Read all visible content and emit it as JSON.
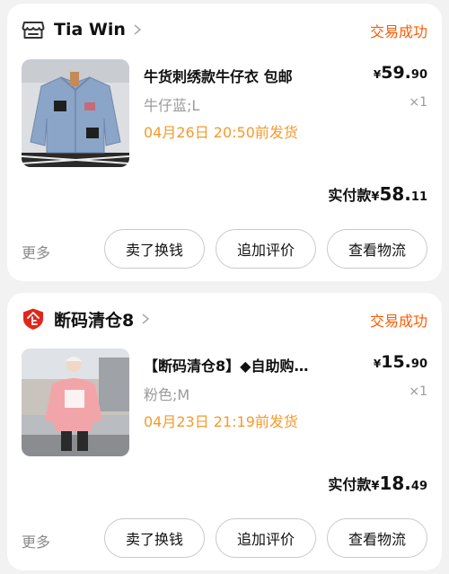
{
  "orders": [
    {
      "shop_name": "Tia Win",
      "status": "交易成功",
      "product_title": "牛货刺绣款牛仔衣 包邮",
      "variant": "牛仔蓝;L",
      "shipping_note": "04月26日 20:50前发货",
      "price": {
        "currency": "¥",
        "integer": "59.",
        "decimal": "90"
      },
      "quantity": "×1",
      "paid": {
        "label": "实付款",
        "currency": "¥",
        "integer": "58.",
        "decimal": "11"
      },
      "more_label": "更多",
      "buttons": [
        "卖了换钱",
        "追加评价",
        "查看物流"
      ],
      "shop_icon": "store-icon",
      "accent_color": "#ff5a00"
    },
    {
      "shop_name": "断码清仓8",
      "status": "交易成功",
      "product_title": "【断码清仓8】◆自助购…",
      "variant": "粉色;M",
      "shipping_note": "04月23日 21:19前发货",
      "price": {
        "currency": "¥",
        "integer": "15.",
        "decimal": "90"
      },
      "quantity": "×1",
      "paid": {
        "label": "实付款",
        "currency": "¥",
        "integer": "18.",
        "decimal": "49"
      },
      "more_label": "更多",
      "buttons": [
        "卖了换钱",
        "追加评价",
        "查看物流"
      ],
      "shop_icon": "enterprise-shield-icon",
      "accent_color": "#e0271c"
    }
  ]
}
